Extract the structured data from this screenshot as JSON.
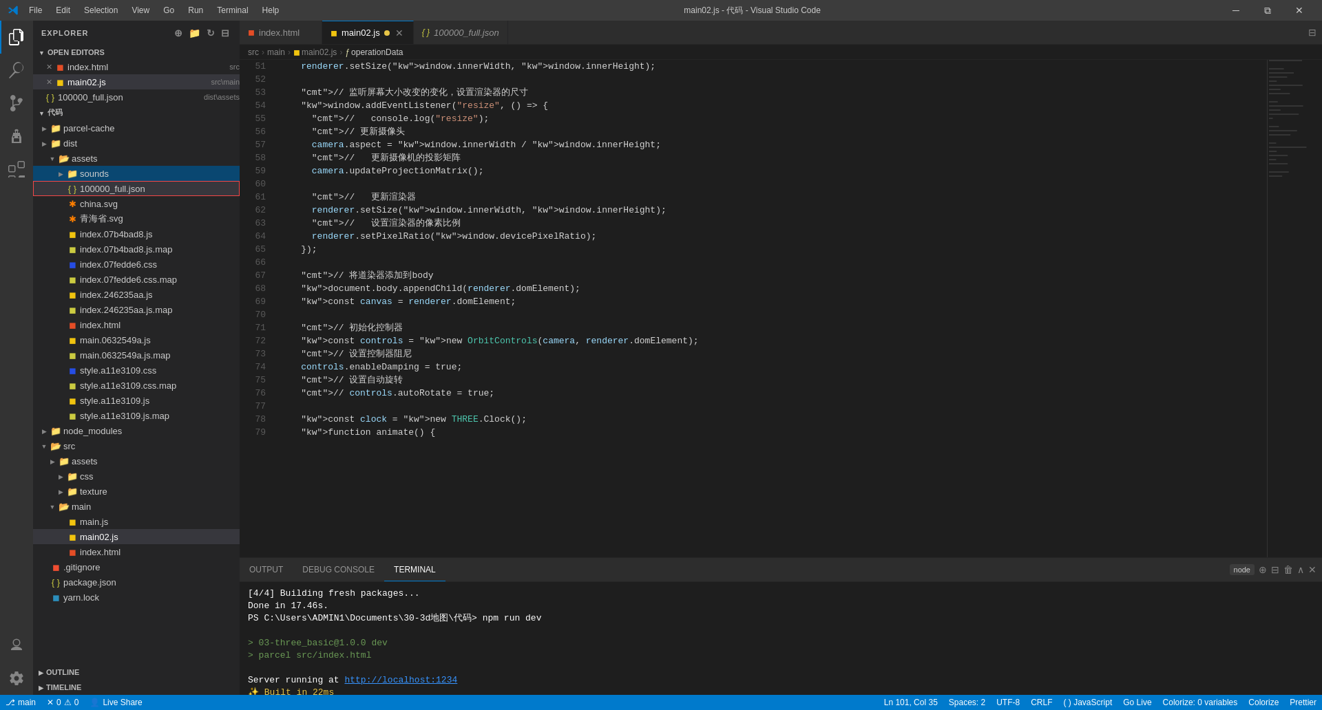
{
  "titleBar": {
    "title": "main02.js - 代码 - Visual Studio Code",
    "menus": [
      "File",
      "Edit",
      "Selection",
      "View",
      "Go",
      "Run",
      "Terminal",
      "Help"
    ],
    "controls": [
      "minimize",
      "maximize",
      "restore",
      "close"
    ]
  },
  "activityBar": {
    "icons": [
      {
        "name": "explorer",
        "symbol": "⎘",
        "active": true
      },
      {
        "name": "search",
        "symbol": "🔍"
      },
      {
        "name": "source-control",
        "symbol": "⎇"
      },
      {
        "name": "run-debug",
        "symbol": "▷"
      },
      {
        "name": "extensions",
        "symbol": "⊞"
      },
      {
        "name": "remote-explorer",
        "symbol": "🖥"
      },
      {
        "name": "accounts",
        "symbol": "◉"
      },
      {
        "name": "settings",
        "symbol": "⚙"
      }
    ]
  },
  "sidebar": {
    "title": "EXPLORER",
    "sections": {
      "openEditors": {
        "label": "OPEN EDITORS",
        "files": [
          {
            "name": "index.html",
            "path": "src",
            "type": "html",
            "modified": false
          },
          {
            "name": "main02.js",
            "path": "src\\main",
            "type": "js",
            "modified": true,
            "active": true
          },
          {
            "name": "100000_full.json",
            "path": "dist\\assets",
            "type": "json",
            "modified": false
          }
        ]
      },
      "explorer": {
        "label": "代码",
        "items": [
          {
            "type": "folder",
            "name": "parcel-cache",
            "indent": 1,
            "expanded": false
          },
          {
            "type": "folder",
            "name": "dist",
            "indent": 1,
            "expanded": false
          },
          {
            "type": "folder",
            "name": "assets",
            "indent": 2,
            "expanded": true
          },
          {
            "type": "folder",
            "name": "sounds",
            "indent": 3,
            "expanded": false,
            "selected": true
          },
          {
            "type": "file",
            "name": "100000_full.json",
            "indent": 3,
            "fileType": "json",
            "highlighted": true
          },
          {
            "type": "file",
            "name": "china.svg",
            "indent": 3,
            "fileType": "svg"
          },
          {
            "type": "file",
            "name": "青海省.svg",
            "indent": 3,
            "fileType": "svg"
          },
          {
            "type": "file",
            "name": "index.07b4bad8.js",
            "indent": 3,
            "fileType": "js"
          },
          {
            "type": "file",
            "name": "index.07b4bad8.js.map",
            "indent": 3,
            "fileType": "map"
          },
          {
            "type": "file",
            "name": "index.07fedde6.css",
            "indent": 3,
            "fileType": "css"
          },
          {
            "type": "file",
            "name": "index.07fedde6.css.map",
            "indent": 3,
            "fileType": "map"
          },
          {
            "type": "file",
            "name": "index.246235aa.js",
            "indent": 3,
            "fileType": "js"
          },
          {
            "type": "file",
            "name": "index.246235aa.js.map",
            "indent": 3,
            "fileType": "map"
          },
          {
            "type": "file",
            "name": "index.html",
            "indent": 3,
            "fileType": "html"
          },
          {
            "type": "file",
            "name": "main.0632549a.js",
            "indent": 3,
            "fileType": "js"
          },
          {
            "type": "file",
            "name": "main.0632549a.js.map",
            "indent": 3,
            "fileType": "map"
          },
          {
            "type": "file",
            "name": "style.a11e3109.css",
            "indent": 3,
            "fileType": "css"
          },
          {
            "type": "file",
            "name": "style.a11e3109.css.map",
            "indent": 3,
            "fileType": "map"
          },
          {
            "type": "file",
            "name": "style.a11e3109.js",
            "indent": 3,
            "fileType": "js"
          },
          {
            "type": "file",
            "name": "style.a11e3109.js.map",
            "indent": 3,
            "fileType": "map"
          },
          {
            "type": "folder",
            "name": "node_modules",
            "indent": 2,
            "expanded": false
          },
          {
            "type": "folder",
            "name": "src",
            "indent": 1,
            "expanded": true
          },
          {
            "type": "folder",
            "name": "assets",
            "indent": 2,
            "expanded": false
          },
          {
            "type": "folder",
            "name": "css",
            "indent": 3,
            "expanded": false
          },
          {
            "type": "folder",
            "name": "texture",
            "indent": 3,
            "expanded": false
          },
          {
            "type": "folder",
            "name": "main",
            "indent": 2,
            "expanded": true
          },
          {
            "type": "file",
            "name": "main.js",
            "indent": 3,
            "fileType": "js"
          },
          {
            "type": "file",
            "name": "main02.js",
            "indent": 3,
            "fileType": "js",
            "active": true
          },
          {
            "type": "file",
            "name": "index.html",
            "indent": 3,
            "fileType": "html"
          },
          {
            "type": "file",
            "name": ".gitignore",
            "indent": 1,
            "fileType": "git"
          },
          {
            "type": "file",
            "name": "package.json",
            "indent": 1,
            "fileType": "json"
          },
          {
            "type": "file",
            "name": "yarn.lock",
            "indent": 1,
            "fileType": "yarn"
          }
        ]
      }
    },
    "outline": {
      "label": "OUTLINE"
    },
    "timeline": {
      "label": "TIMELINE"
    }
  },
  "tabs": [
    {
      "label": "index.html",
      "type": "html",
      "active": false,
      "modified": false,
      "closable": false
    },
    {
      "label": "main02.js",
      "type": "js",
      "active": true,
      "modified": true,
      "closable": true
    },
    {
      "label": "100000_full.json",
      "type": "json",
      "active": false,
      "modified": false,
      "closable": false,
      "preview": true
    }
  ],
  "breadcrumb": [
    "src",
    "main",
    "main02.js",
    "operationData"
  ],
  "codeLines": [
    {
      "num": 51,
      "content": "    renderer.setSize(window.innerWidth, window.innerHeight);"
    },
    {
      "num": 52,
      "content": ""
    },
    {
      "num": 53,
      "content": "    // 监听屏幕大小改变的变化，设置渲染器的尺寸"
    },
    {
      "num": 54,
      "content": "    window.addEventListener(\"resize\", () => {"
    },
    {
      "num": 55,
      "content": "      //   console.log(\"resize\");"
    },
    {
      "num": 56,
      "content": "      // 更新摄像头"
    },
    {
      "num": 57,
      "content": "      camera.aspect = window.innerWidth / window.innerHeight;"
    },
    {
      "num": 58,
      "content": "      //   更新摄像机的投影矩阵"
    },
    {
      "num": 59,
      "content": "      camera.updateProjectionMatrix();"
    },
    {
      "num": 60,
      "content": ""
    },
    {
      "num": 61,
      "content": "      //   更新渲染器"
    },
    {
      "num": 62,
      "content": "      renderer.setSize(window.innerWidth, window.innerHeight);"
    },
    {
      "num": 63,
      "content": "      //   设置渲染器的像素比例"
    },
    {
      "num": 64,
      "content": "      renderer.setPixelRatio(window.devicePixelRatio);"
    },
    {
      "num": 65,
      "content": "    });"
    },
    {
      "num": 66,
      "content": ""
    },
    {
      "num": 67,
      "content": "    // 将道染器添加到body"
    },
    {
      "num": 68,
      "content": "    document.body.appendChild(renderer.domElement);"
    },
    {
      "num": 69,
      "content": "    const canvas = renderer.domElement;"
    },
    {
      "num": 70,
      "content": ""
    },
    {
      "num": 71,
      "content": "    // 初始化控制器"
    },
    {
      "num": 72,
      "content": "    const controls = new OrbitControls(camera, renderer.domElement);"
    },
    {
      "num": 73,
      "content": "    // 设置控制器阻尼"
    },
    {
      "num": 74,
      "content": "    controls.enableDamping = true;"
    },
    {
      "num": 75,
      "content": "    // 设置自动旋转"
    },
    {
      "num": 76,
      "content": "    // controls.autoRotate = true;"
    },
    {
      "num": 77,
      "content": ""
    },
    {
      "num": 78,
      "content": "    const clock = new THREE.Clock();"
    },
    {
      "num": 79,
      "content": "    function animate() {"
    }
  ],
  "panel": {
    "tabs": [
      "OUTPUT",
      "DEBUG CONSOLE",
      "TERMINAL"
    ],
    "activeTab": "TERMINAL",
    "terminalLines": [
      {
        "text": "[4/4] Building fresh packages...",
        "color": "white"
      },
      {
        "text": "Done in 17.46s.",
        "color": "white"
      },
      {
        "text": "PS C:\\Users\\ADMIN1\\Documents\\30-3d地图\\代码> npm run dev",
        "color": "white"
      },
      {
        "text": "",
        "color": "white"
      },
      {
        "text": "> 03-three_basic@1.0.0 dev",
        "color": "green"
      },
      {
        "text": "> parcel src/index.html",
        "color": "green"
      },
      {
        "text": "",
        "color": "white"
      },
      {
        "text": "Server running at http://localhost:1234",
        "color": "white",
        "hasLink": true
      },
      {
        "text": "✨ Built in 22ms",
        "color": "gold"
      },
      {
        "text": "",
        "color": "white",
        "cursor": true
      }
    ],
    "nodeLabel": "node"
  },
  "statusBar": {
    "left": [
      {
        "icon": "⌥",
        "text": "0"
      },
      {
        "icon": "△",
        "text": "0"
      },
      {
        "icon": "⚠",
        "text": "0"
      },
      {
        "text": "main",
        "icon": "⎇"
      }
    ],
    "right": [
      {
        "text": "Ln 101, Col 35"
      },
      {
        "text": "Spaces: 2"
      },
      {
        "text": "UTF-8"
      },
      {
        "text": "CRLF"
      },
      {
        "text": "() JavaScript"
      },
      {
        "text": "Go Live"
      },
      {
        "text": "Colorize: 0 variables"
      },
      {
        "text": "Colorize"
      },
      {
        "text": "Prettier"
      }
    ]
  }
}
